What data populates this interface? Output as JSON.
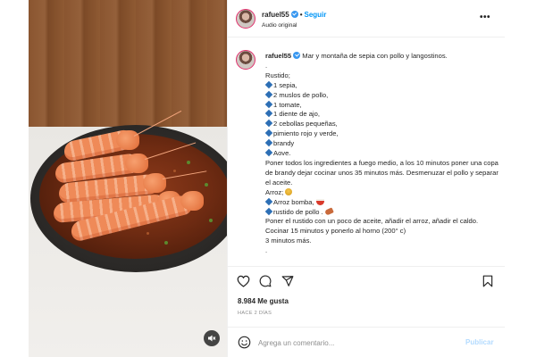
{
  "header": {
    "username": "rafuel55",
    "separator": "•",
    "follow_label": "Seguir",
    "audio_label": "Audio original",
    "more_icon": "more-horizontal-icon"
  },
  "caption": {
    "username": "rafuel55",
    "title": "Mar y montaña de sepia con pollo y langostinos.",
    "lines": [
      ".",
      "Rustido;",
      "1 sepia,",
      "2 muslos de pollo,",
      "1 tomate,",
      "1 diente de ajo,",
      "2 cebollas pequeñas,",
      "pimiento rojo y verde,",
      "brandy",
      "Aove."
    ],
    "paragraph_1": "Poner todos los ingredientes a fuego medio, a los 10 minutos poner una copa de brandy dejar cocinar unos 35 minutos más. Desmenuzar el pollo y separar el aceite.",
    "rice_heading": "Arroz;",
    "rice_line_1": "Arroz bomba,",
    "rice_line_2": "rustido de pollo .",
    "paragraph_2": "Poner el rustido con un poco de aceite, añadir el arroz, añadir el caldo. Cocinar 15 minutos y ponerlo al horno (200° c)",
    "paragraph_3": "3 minutos más.",
    "trailing": "."
  },
  "engagement": {
    "likes_text": "8.984 Me gusta",
    "time_ago": "HACE 2 DÍAS"
  },
  "comment": {
    "placeholder": "Agrega un comentario...",
    "publish_label": "Publicar"
  },
  "colors": {
    "accent_blue": "#0095f6",
    "publish_disabled": "#b3dbff",
    "bullet_blue": "#2d6fb5",
    "verified_blue": "#3897f0"
  }
}
